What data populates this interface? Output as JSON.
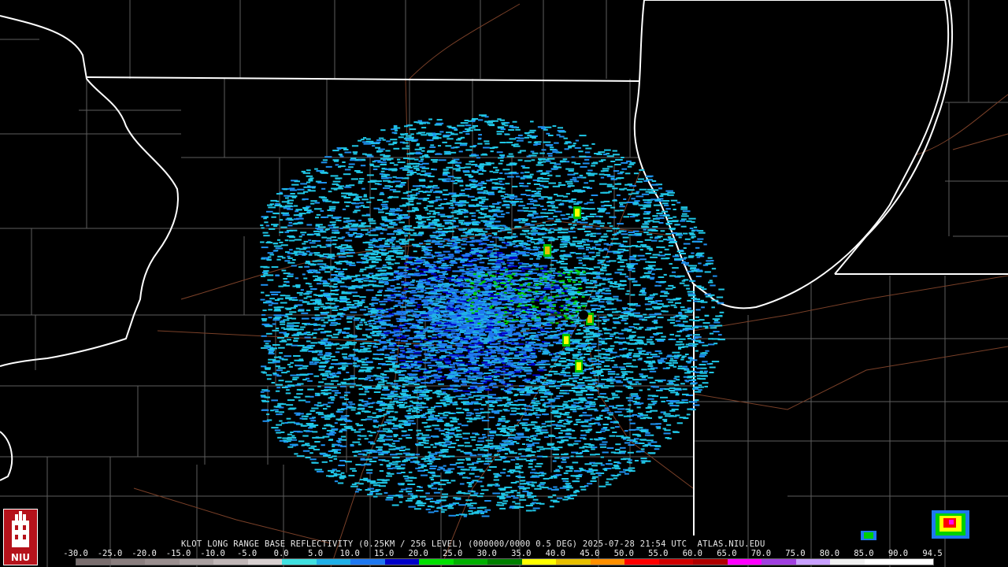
{
  "title": "KLOT LONG RANGE BASE REFLECTIVITY (0.25KM / 256 LEVEL) (000000/0000 0.5 DEG) 2025-07-28 21:54 UTC  ATLAS.NIU.EDU",
  "logo": {
    "text": "NIU",
    "icon": "university-tower-icon"
  },
  "scale": {
    "labels": [
      "-30.0",
      "-25.0",
      "-20.0",
      "-15.0",
      "-10.0",
      "-5.0",
      "0.0",
      "5.0",
      "10.0",
      "15.0",
      "20.0",
      "25.0",
      "30.0",
      "35.0",
      "40.0",
      "45.0",
      "50.0",
      "55.0",
      "60.0",
      "65.0",
      "70.0",
      "75.0",
      "80.0",
      "85.0",
      "90.0",
      "94.5"
    ],
    "colors": [
      "#7a6e6e",
      "#8a7e7e",
      "#9a8e8e",
      "#aaa0a0",
      "#c0b6b6",
      "#d8d0d0",
      "#40e0e0",
      "#20b0e8",
      "#1e78f0",
      "#0000c8",
      "#00e000",
      "#00b000",
      "#008000",
      "#ffff00",
      "#e8c000",
      "#ff9000",
      "#ff0000",
      "#d00000",
      "#b00000",
      "#ff00ff",
      "#a040e0",
      "#c8a0ff",
      "#f0f0f0",
      "#ffffff",
      "#ffffff"
    ]
  },
  "map": {
    "radar_site": "KLOT",
    "land_color": "#000000",
    "state_border_color": "#ffffff",
    "county_line_color": "#6a6a6a",
    "road_color": "#8b4a2f"
  }
}
